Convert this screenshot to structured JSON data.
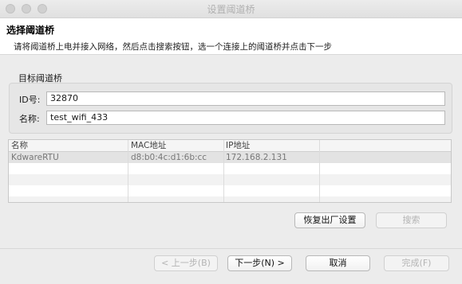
{
  "window": {
    "title": "设置阈道桥"
  },
  "header": {
    "title": "选择阈道桥",
    "description": "请将阈道桥上电并接入网络，然后点击搜索按钮，选一个连接上的阈道桥并点击下一步"
  },
  "group": {
    "label": "目标阈道桥",
    "id_label": "ID号:",
    "id_value": "32870",
    "name_label": "名称:",
    "name_value": "test_wifi_433"
  },
  "table": {
    "columns": [
      "名称",
      "MAC地址",
      "IP地址"
    ],
    "rows": [
      [
        "KdwareRTU",
        "d8:b0:4c:d1:6b:cc",
        "172.168.2.131"
      ]
    ]
  },
  "actions": {
    "reset": "恢复出厂设置",
    "search": "搜索"
  },
  "footer": {
    "prev": "< 上一步(B)",
    "next": "下一步(N) >",
    "cancel": "取消",
    "finish": "完成(F)"
  }
}
